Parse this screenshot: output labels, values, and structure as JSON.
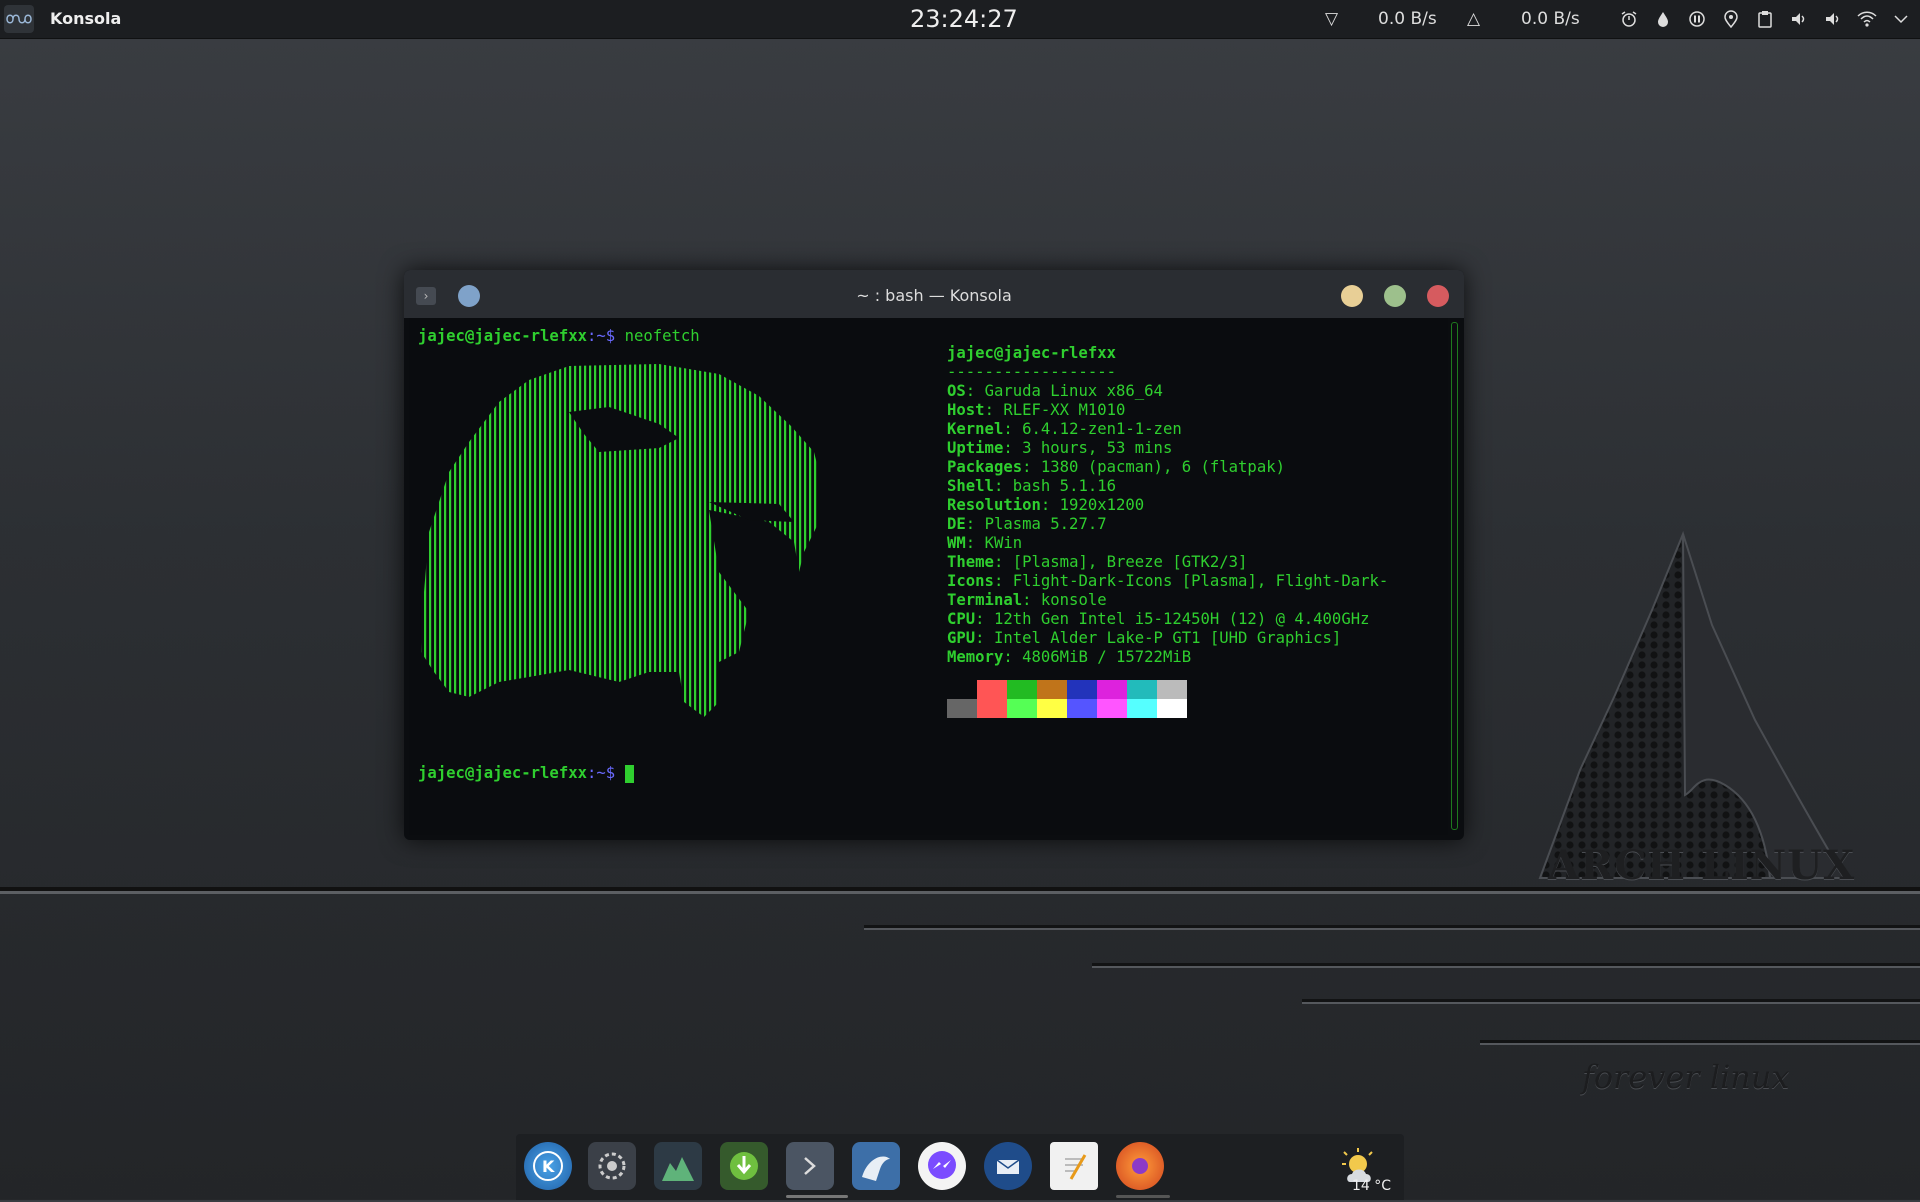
{
  "top_panel": {
    "app_name": "Konsola",
    "clock": "23:24:27",
    "net_down": "0.0 B/s",
    "net_up": "0.0 B/s",
    "down_arrow": "▽",
    "up_arrow": "△",
    "tray_icons": [
      "alarm-icon",
      "drop-icon",
      "pause-icon",
      "location-icon",
      "clipboard-icon",
      "volume-icon",
      "volume-alt-icon",
      "wifi-icon",
      "chevron-down-icon"
    ]
  },
  "wallpaper": {
    "arch_text": "ARCH LINUX",
    "forever_text": "forever linux"
  },
  "window": {
    "title": "~ : bash — Konsola",
    "prompt_user": "jajec@jajec-rlefxx",
    "prompt_path": ":~",
    "prompt_symbol": "$ ",
    "command": "neofetch",
    "info_header": "jajec@jajec-rlefxx",
    "info_separator": "------------------",
    "info": [
      {
        "key": "OS",
        "value": "Garuda Linux x86_64"
      },
      {
        "key": "Host",
        "value": "RLEF-XX M1010"
      },
      {
        "key": "Kernel",
        "value": "6.4.12-zen1-1-zen"
      },
      {
        "key": "Uptime",
        "value": "3 hours, 53 mins"
      },
      {
        "key": "Packages",
        "value": "1380 (pacman), 6 (flatpak)"
      },
      {
        "key": "Shell",
        "value": "bash 5.1.16"
      },
      {
        "key": "Resolution",
        "value": "1920x1200"
      },
      {
        "key": "DE",
        "value": "Plasma 5.27.7"
      },
      {
        "key": "WM",
        "value": "KWin"
      },
      {
        "key": "Theme",
        "value": "[Plasma], Breeze [GTK2/3]"
      },
      {
        "key": "Icons",
        "value": "Flight-Dark-Icons [Plasma], Flight-Dark-"
      },
      {
        "key": "Terminal",
        "value": "konsole"
      },
      {
        "key": "CPU",
        "value": "12th Gen Intel i5-12450H (12) @ 4.400GHz"
      },
      {
        "key": "GPU",
        "value": "Intel Alder Lake-P GT1 [UHD Graphics]"
      },
      {
        "key": "Memory",
        "value": "4806MiB / 15722MiB"
      }
    ],
    "palette_top": [
      "#0a0c0f",
      "#ff5555",
      "#22bb22",
      "#c0741a",
      "#2233bb",
      "#dd22dd",
      "#22bbbb",
      "#bbbbbb"
    ],
    "palette_bottom": [
      "#666666",
      "#ff5555",
      "#55ff55",
      "#ffff44",
      "#5555ff",
      "#ff55ff",
      "#55ffff",
      "#ffffff"
    ]
  },
  "dock": {
    "items": [
      "kde-launcher-icon",
      "settings-icon",
      "system-monitor-icon",
      "downloader-icon",
      "terminal-icon",
      "dolphin-file-manager-icon",
      "messenger-icon",
      "thunderbird-icon",
      "text-editor-icon",
      "firefox-icon"
    ],
    "temperature": "14 °C"
  }
}
